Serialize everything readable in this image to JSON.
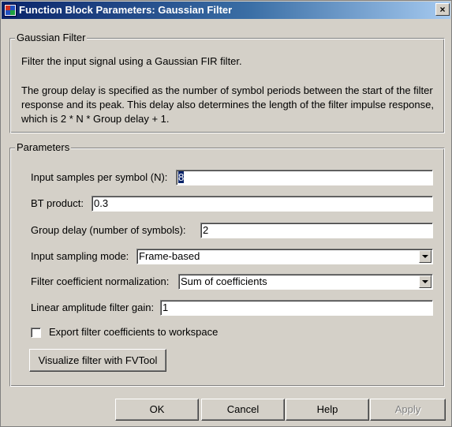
{
  "window": {
    "title": "Function Block Parameters: Gaussian Filter",
    "close_glyph": "×",
    "app_icon": "simulink-block-icon"
  },
  "description_group": {
    "legend": "Gaussian Filter",
    "line1": "Filter the input signal using a Gaussian FIR filter.",
    "line2": "The group delay is specified as the number of symbol periods between the start of the filter response and its peak. This delay also determines the length of the filter impulse response, which is 2 * N * Group delay + 1."
  },
  "parameters_group": {
    "legend": "Parameters",
    "input_samples": {
      "label": "Input samples per symbol (N):",
      "value": "8"
    },
    "bt_product": {
      "label": "BT product:",
      "value": "0.3"
    },
    "group_delay": {
      "label": "Group delay (number of symbols):",
      "value": "2"
    },
    "sampling_mode": {
      "label": "Input sampling mode:",
      "selected": "Frame-based"
    },
    "normalization": {
      "label": "Filter coefficient normalization:",
      "selected": "Sum of coefficients"
    },
    "amplitude_gain": {
      "label": "Linear amplitude filter gain:",
      "value": "1"
    },
    "export_checkbox": {
      "label": "Export filter coefficients to workspace",
      "checked": false
    },
    "visualize_button": "Visualize filter with FVTool"
  },
  "buttons": {
    "ok": "OK",
    "cancel": "Cancel",
    "help": "Help",
    "apply": "Apply"
  },
  "colors": {
    "face": "#d4d0c8",
    "title_start": "#0a246a",
    "title_end": "#a6caf0",
    "selection": "#0a246a",
    "disabled_text": "#808080"
  }
}
